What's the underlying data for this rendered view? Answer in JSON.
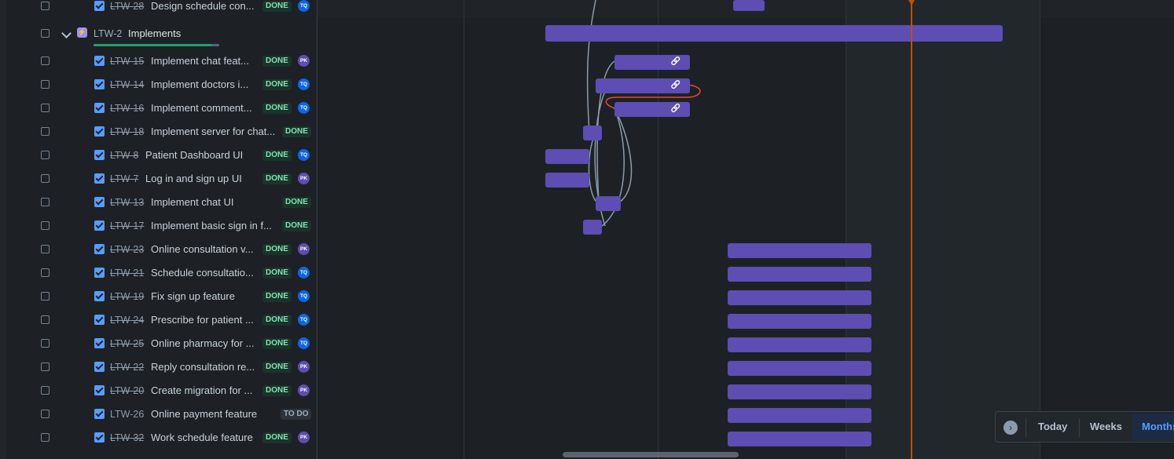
{
  "epic": {
    "key": "LTW-2",
    "summary": "Implements",
    "progress_done_fraction": 0.94
  },
  "rows": [
    {
      "key": "LTW-28",
      "summary": "Design schedule con...",
      "status": "DONE",
      "avatar": "TQ",
      "done": true
    },
    {
      "key": "LTW-15",
      "summary": "Implement chat feat...",
      "status": "DONE",
      "avatar": "PK",
      "done": true
    },
    {
      "key": "LTW-14",
      "summary": "Implement doctors i...",
      "status": "DONE",
      "avatar": "TQ",
      "done": true
    },
    {
      "key": "LTW-16",
      "summary": "Implement comment...",
      "status": "DONE",
      "avatar": "TQ",
      "done": true
    },
    {
      "key": "LTW-18",
      "summary": "Implement server for chat...",
      "status": "DONE",
      "avatar": "",
      "done": true
    },
    {
      "key": "LTW-8",
      "summary": "Patient Dashboard UI",
      "status": "DONE",
      "avatar": "TQ",
      "done": true
    },
    {
      "key": "LTW-7",
      "summary": "Log in and sign up UI",
      "status": "DONE",
      "avatar": "PK",
      "done": true
    },
    {
      "key": "LTW-13",
      "summary": "Implement chat UI",
      "status": "DONE",
      "avatar": "",
      "done": true
    },
    {
      "key": "LTW-17",
      "summary": "Implement basic sign in f...",
      "status": "DONE",
      "avatar": "",
      "done": true
    },
    {
      "key": "LTW-23",
      "summary": "Online consultation v...",
      "status": "DONE",
      "avatar": "PK",
      "done": true
    },
    {
      "key": "LTW-21",
      "summary": "Schedule consultatio...",
      "status": "DONE",
      "avatar": "TQ",
      "done": true
    },
    {
      "key": "LTW-19",
      "summary": "Fix sign up feature",
      "status": "DONE",
      "avatar": "TQ",
      "done": true
    },
    {
      "key": "LTW-24",
      "summary": "Prescribe for patient ...",
      "status": "DONE",
      "avatar": "TQ",
      "done": true
    },
    {
      "key": "LTW-25",
      "summary": "Online pharmacy for ...",
      "status": "DONE",
      "avatar": "TQ",
      "done": true
    },
    {
      "key": "LTW-22",
      "summary": "Reply consultation re...",
      "status": "DONE",
      "avatar": "PK",
      "done": true
    },
    {
      "key": "LTW-20",
      "summary": "Create migration for ...",
      "status": "DONE",
      "avatar": "PK",
      "done": true
    },
    {
      "key": "LTW-26",
      "summary": "Online payment feature",
      "status": "TO DO",
      "avatar": "",
      "done": false
    },
    {
      "key": "LTW-32",
      "summary": "Work schedule feature",
      "status": "DONE",
      "avatar": "PK",
      "done": true
    }
  ],
  "controls": {
    "today": "Today",
    "weeks": "Weeks",
    "months": "Months"
  },
  "colors": {
    "bar": "#5e4db2",
    "today_line": "#c25100",
    "done_lozenge": "#7ee2b8",
    "avatar_pk": "#5e4db2",
    "avatar_tq": "#0c66e4"
  }
}
